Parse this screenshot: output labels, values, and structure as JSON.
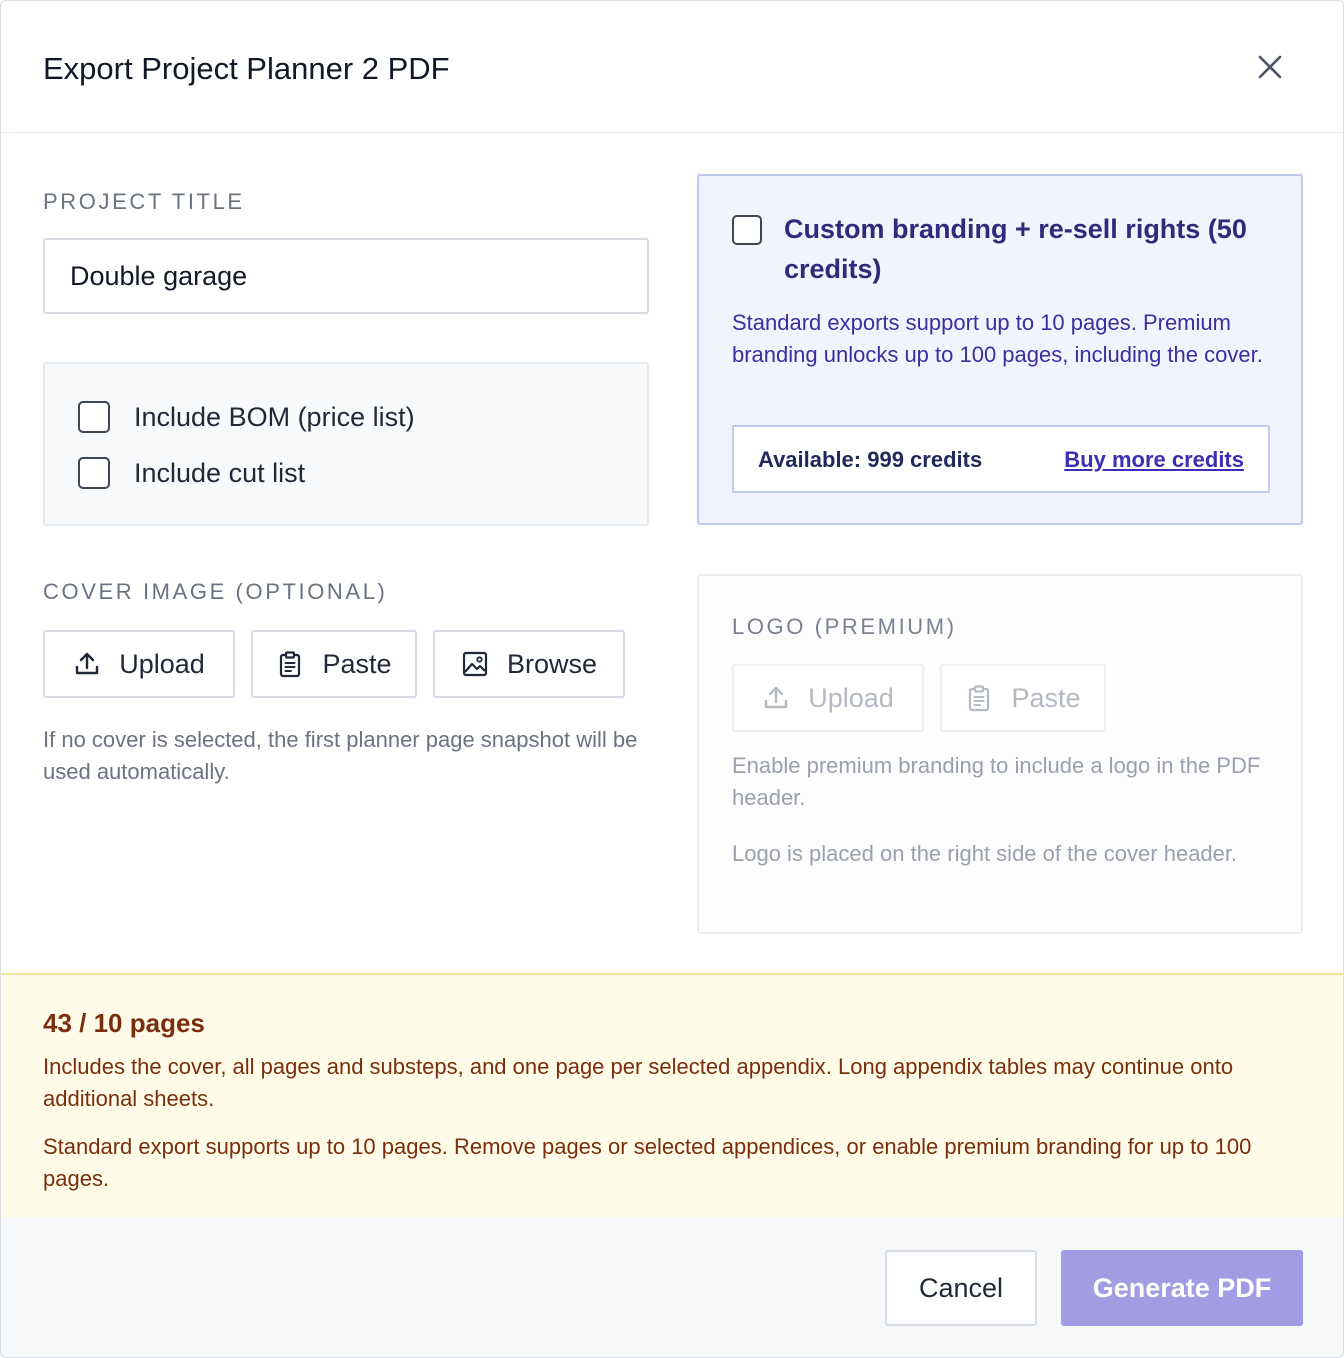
{
  "dialog": {
    "title": "Export Project Planner 2 PDF",
    "close_icon": "close-icon"
  },
  "project_title": {
    "label": "PROJECT TITLE",
    "value": "Double garage"
  },
  "appendices": [
    {
      "label": "Include BOM (price list)",
      "checked": false
    },
    {
      "label": "Include cut list",
      "checked": false
    }
  ],
  "cover_image": {
    "label": "COVER IMAGE (OPTIONAL)",
    "buttons": [
      {
        "label": "Upload",
        "icon": "upload-icon"
      },
      {
        "label": "Paste",
        "icon": "clipboard-icon"
      },
      {
        "label": "Browse",
        "icon": "image-icon"
      }
    ],
    "helper": "If no cover is selected, the first planner page snapshot will be used automatically."
  },
  "branding": {
    "checkbox_label": "Custom branding + re-sell rights (50 credits)",
    "checked": false,
    "description": "Standard exports support up to 10 pages. Premium branding unlocks up to 100 pages, including the cover.",
    "credits_available": "Available: 999 credits",
    "buy_more_label": "Buy more credits"
  },
  "logo": {
    "label": "LOGO (PREMIUM)",
    "buttons": [
      {
        "label": "Upload",
        "icon": "upload-icon"
      },
      {
        "label": "Paste",
        "icon": "clipboard-icon"
      }
    ],
    "note_1": "Enable premium branding to include a logo in the PDF header.",
    "note_2": "Logo is placed on the right side of the cover header."
  },
  "page_warning": {
    "count": "43 / 10 pages",
    "detail_1": "Includes the cover, all pages and substeps, and one page per selected appendix. Long appendix tables may continue onto additional sheets.",
    "detail_2": "Standard export supports up to 10 pages. Remove pages or selected appendices, or enable premium branding for up to 100 pages."
  },
  "footer": {
    "cancel_label": "Cancel",
    "generate_label": "Generate PDF"
  },
  "colors": {
    "accent_disabled": "#a49ce3",
    "branding_bg": "#f1f3fd",
    "warning_bg": "#fefbe8",
    "warning_text": "#7a2e0e"
  }
}
